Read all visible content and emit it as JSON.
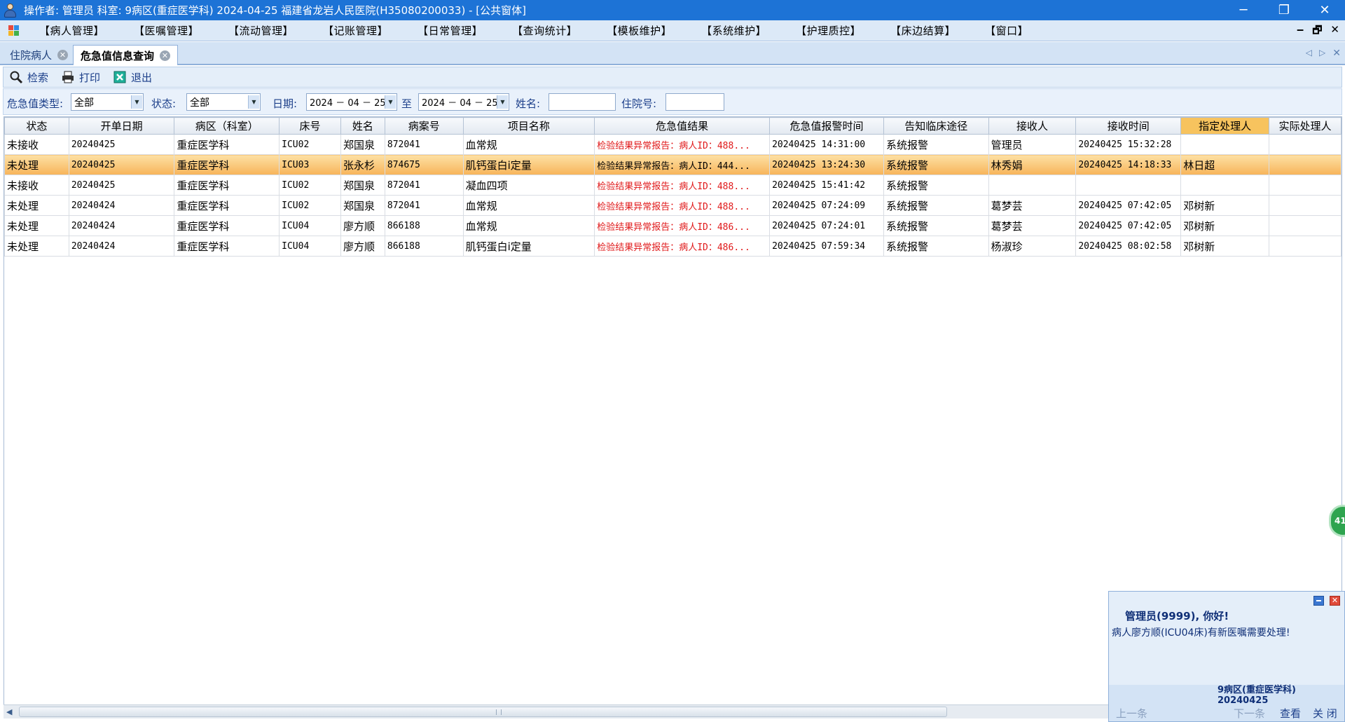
{
  "window": {
    "title": "操作者: 管理员  科室: 9病区(重症医学科)  2024-04-25  福建省龙岩人民医院(H35080200033) - [公共窗体]",
    "minimize": "─",
    "restore": "❐",
    "close": "✕"
  },
  "menu": [
    "【病人管理】",
    "【医嘱管理】",
    "【流动管理】",
    "【记账管理】",
    "【日常管理】",
    "【查询统计】",
    "【模板维护】",
    "【系统维护】",
    "【护理质控】",
    "【床边结算】",
    "【窗口】"
  ],
  "mdi_controls": {
    "minimize": "‒",
    "restore": "🗗",
    "close": "✕"
  },
  "tabs": [
    {
      "label": "住院病人"
    },
    {
      "label": "危急值信息查询",
      "active": true
    }
  ],
  "toolbar": {
    "search": "检索",
    "print": "打印",
    "exit": "退出"
  },
  "filters": {
    "type_label": "危急值类型:",
    "type_value": "全部",
    "status_label": "状态:",
    "status_value": "全部",
    "date_label": "日期:",
    "date_from": "2024 － 04 － 25",
    "to_label": "至",
    "date_to": "2024 － 04 － 25",
    "name_label": "姓名:",
    "name_value": "",
    "admission_label": "住院号:",
    "admission_value": ""
  },
  "table": {
    "columns": [
      "状态",
      "开单日期",
      "病区（科室）",
      "床号",
      "姓名",
      "病案号",
      "项目名称",
      "危急值结果",
      "危急值报警时间",
      "告知临床途径",
      "接收人",
      "接收时间",
      "指定处理人",
      "实际处理人"
    ],
    "highlight_column": "指定处理人",
    "selected_row": 1,
    "rows": [
      [
        "未接收",
        "20240425",
        "重症医学科",
        "ICU02",
        "郑国泉",
        "872041",
        "血常规",
        "检验结果异常报告：病人ID：488...",
        "20240425 14:31:00",
        "系统报警",
        "管理员",
        "20240425 15:32:28",
        "",
        ""
      ],
      [
        "未处理",
        "20240425",
        "重症医学科",
        "ICU03",
        "张永杉",
        "874675",
        "肌钙蛋白i定量",
        "检验结果异常报告：病人ID：444...",
        "20240425 13:24:30",
        "系统报警",
        "林秀娟",
        "20240425 14:18:33",
        "林日超",
        ""
      ],
      [
        "未接收",
        "20240425",
        "重症医学科",
        "ICU02",
        "郑国泉",
        "872041",
        "凝血四项",
        "检验结果异常报告：病人ID：488...",
        "20240425 15:41:42",
        "系统报警",
        "",
        "",
        "",
        ""
      ],
      [
        "未处理",
        "20240424",
        "重症医学科",
        "ICU02",
        "郑国泉",
        "872041",
        "血常规",
        "检验结果异常报告：病人ID：488...",
        "20240425 07:24:09",
        "系统报警",
        "葛梦芸",
        "20240425 07:42:05",
        "邓树新",
        ""
      ],
      [
        "未处理",
        "20240424",
        "重症医学科",
        "ICU04",
        "廖方顺",
        "866188",
        "血常规",
        "检验结果异常报告：病人ID：486...",
        "20240425 07:24:01",
        "系统报警",
        "葛梦芸",
        "20240425 07:42:05",
        "邓树新",
        ""
      ],
      [
        "未处理",
        "20240424",
        "重症医学科",
        "ICU04",
        "廖方顺",
        "866188",
        "肌钙蛋白i定量",
        "检验结果异常报告：病人ID：486...",
        "20240425 07:59:34",
        "系统报警",
        "杨淑珍",
        "20240425 08:02:58",
        "邓树新",
        ""
      ]
    ]
  },
  "badge": {
    "text": "41"
  },
  "popup": {
    "greeting": "管理员(9999), 你好!",
    "message": "病人廖方顺(ICU04床)有新医嘱需要处理!",
    "ward": "9病区(重症医学科)",
    "date": "20240425",
    "prev": "上一条",
    "next": "下一条",
    "view": "查看",
    "close": "关 闭"
  },
  "colors": {
    "title_bar": "#1d73d6",
    "selected_row": "#f7b45a",
    "alert_text": "#e0191a",
    "highlight_header": "#f7c35e"
  }
}
